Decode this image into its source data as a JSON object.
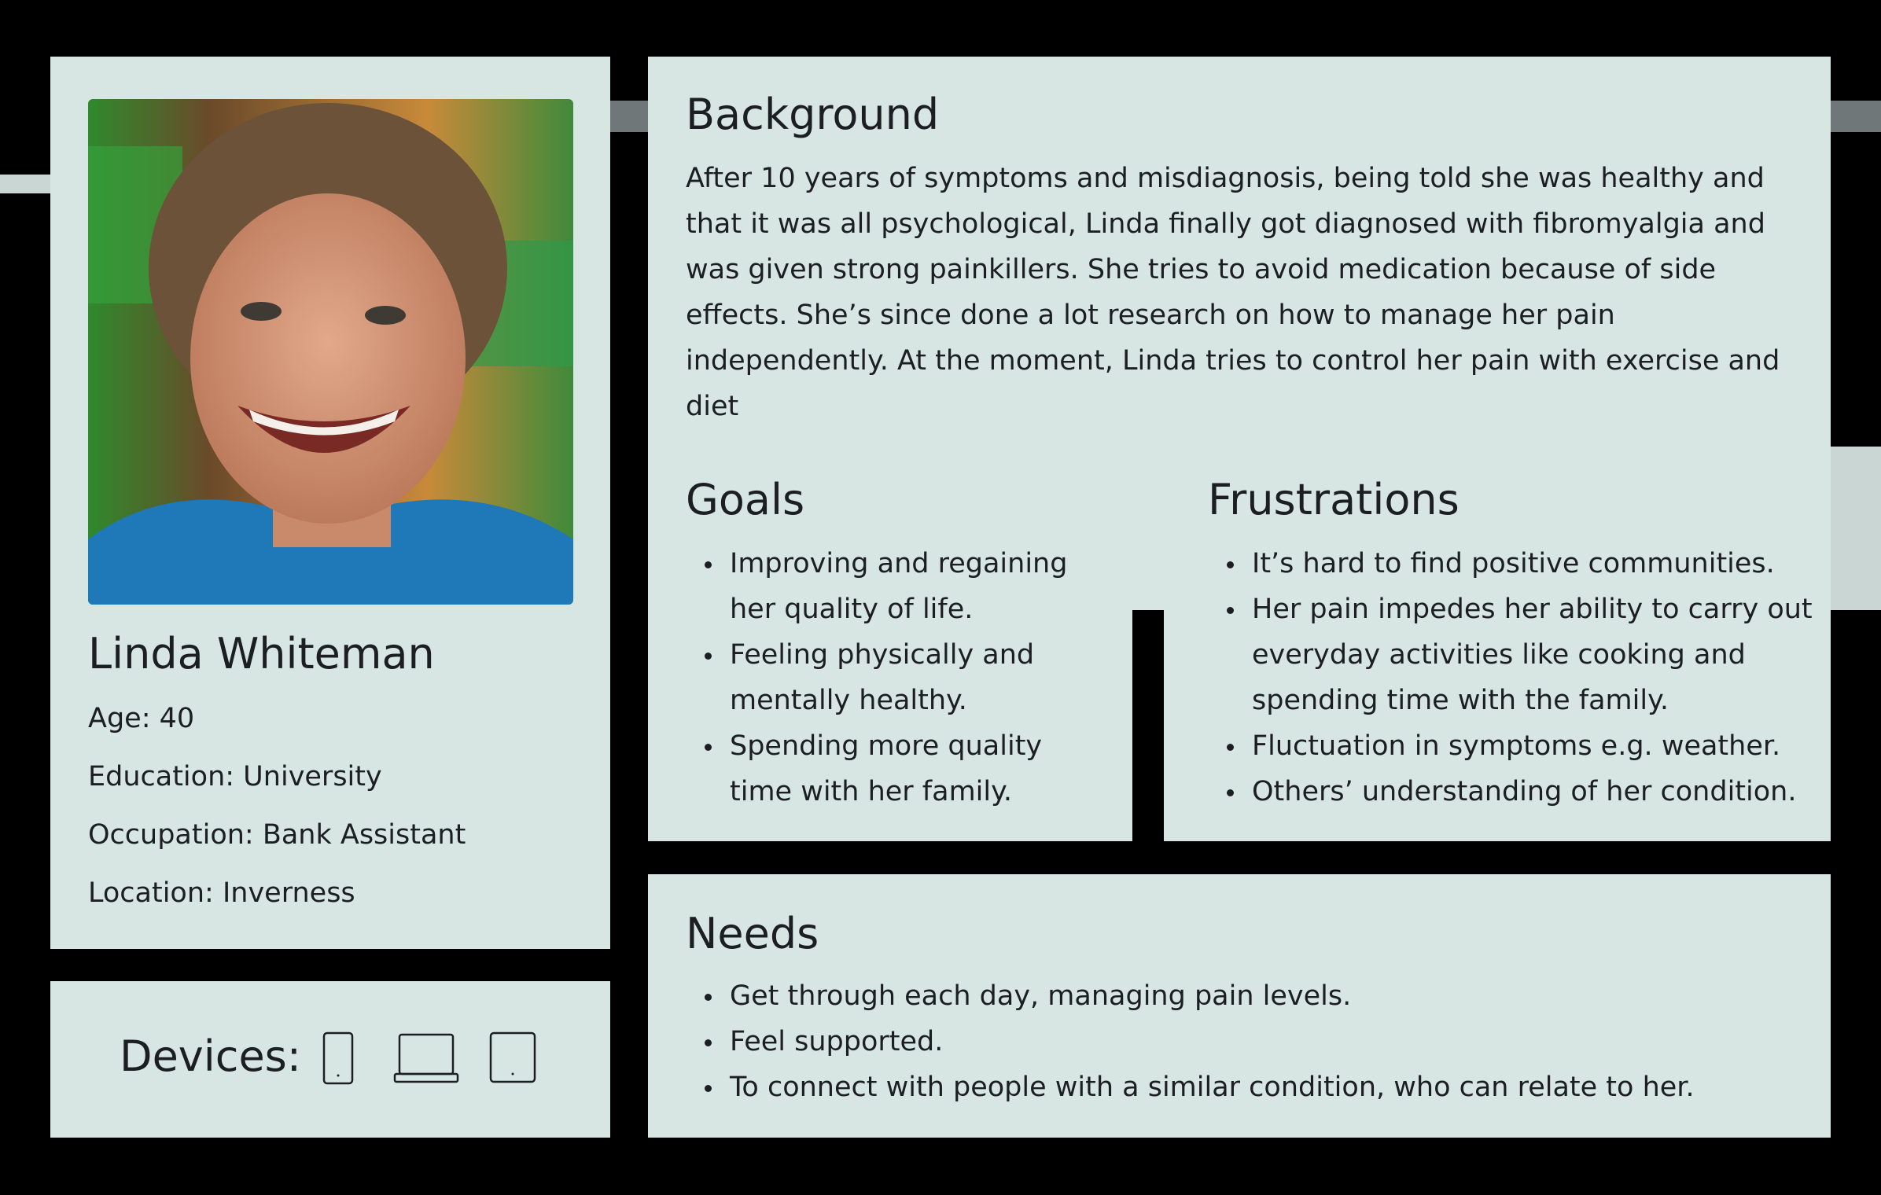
{
  "profile": {
    "name": "Linda Whiteman",
    "age": "Age: 40",
    "education": "Education: University",
    "occupation": "Occupation: Bank Assistant",
    "location": "Location: Inverness"
  },
  "devices": {
    "label": "Devices:",
    "icons": [
      "smartphone-icon",
      "laptop-icon",
      "tablet-icon"
    ]
  },
  "background": {
    "title": "Background",
    "text": "After 10 years of symptoms and misdiagnosis, being told she was healthy and that it was all psychological, Linda finally got diagnosed with fibromyalgia and was given strong painkillers. She tries to avoid medication because of side effects. She’s since done a lot research on how to manage her pain independently. At the moment, Linda tries to control her pain with exercise and diet"
  },
  "goals": {
    "title": "Goals",
    "items": [
      "Improving and regaining her quality of life.",
      "Feeling physically and mentally healthy.",
      "Spending more quality time with her family."
    ]
  },
  "frustrations": {
    "title": "Frustrations",
    "items": [
      "It’s hard to find positive communities.",
      "Her pain impedes her ability to carry out everyday activities like cooking and spending time with the family.",
      "Fluctuation in symptoms e.g. weather.",
      "Others’ understanding of her condition."
    ]
  },
  "needs": {
    "title": "Needs",
    "items": [
      "Get through each day, managing pain levels.",
      "Feel supported.",
      "To connect with people with a similar condition, who can relate to her."
    ]
  },
  "colors": {
    "page_background": "#000000",
    "card_background": "#d8e6e3",
    "text": "#1c1f22",
    "accent_strip": "#6f7778"
  }
}
